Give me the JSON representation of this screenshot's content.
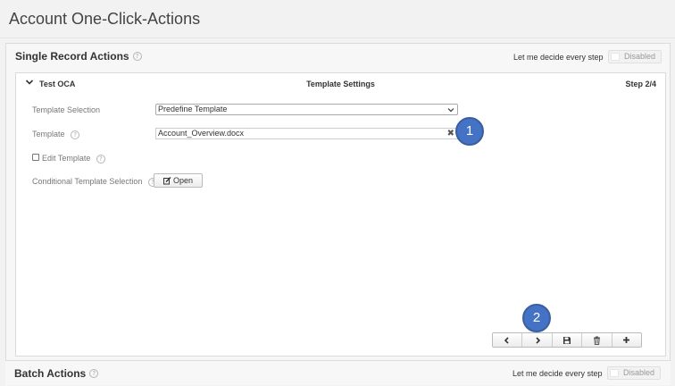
{
  "page": {
    "title": "Account One-Click-Actions"
  },
  "single_record": {
    "title": "Single Record Actions",
    "decide_label": "Let me decide every step",
    "toggle_label": "Disabled"
  },
  "oca": {
    "name": "Test OCA",
    "step_title": "Template Settings",
    "step_count": "Step 2/4",
    "fields": {
      "template_selection_label": "Template Selection",
      "template_selection_value": "Predefine Template",
      "template_label": "Template",
      "template_value": "Account_Overview.docx",
      "edit_template_label": "Edit Template",
      "conditional_label": "Conditional Template Selection",
      "open_label": "Open"
    }
  },
  "markers": {
    "one": "1",
    "two": "2"
  },
  "batch": {
    "title": "Batch Actions",
    "decide_label": "Let me decide every step",
    "toggle_label": "Disabled"
  },
  "icons": {
    "help": "question-circle-icon",
    "chevron": "chevron-down-icon",
    "clear": "close-icon",
    "open": "edit-icon",
    "prev": "chevron-left-icon",
    "next": "chevron-right-icon",
    "save": "save-icon",
    "delete": "trash-icon",
    "add": "plus-icon"
  },
  "colors": {
    "marker": "#4472c4"
  }
}
